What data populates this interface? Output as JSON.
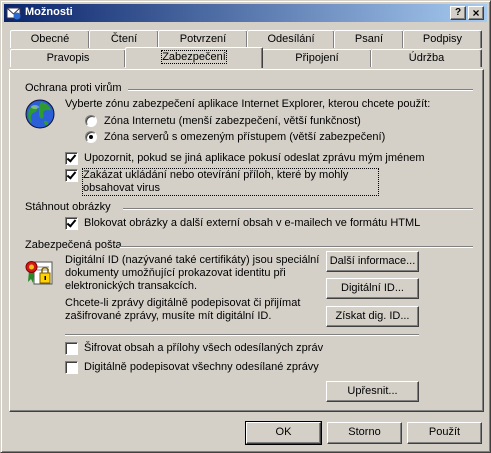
{
  "window": {
    "title": "Možnosti",
    "help_label": "?",
    "close_label": "×"
  },
  "tabs_back": [
    {
      "label": "Obecné"
    },
    {
      "label": "Čtení"
    },
    {
      "label": "Potvrzení"
    },
    {
      "label": "Odesílání"
    },
    {
      "label": "Psaní"
    },
    {
      "label": "Podpisy"
    }
  ],
  "tabs_front": [
    {
      "label": "Pravopis"
    },
    {
      "label": "Zabezpečení",
      "active": true
    },
    {
      "label": "Připojení"
    },
    {
      "label": "Údržba"
    }
  ],
  "virus": {
    "heading": "Ochrana proti virům",
    "zone_prompt": "Vyberte zónu zabezpečení aplikace Internet Explorer, kterou chcete použít:",
    "zone_internet": "Zóna Internetu (menší zabezpečení, větší funkčnost)",
    "zone_internet_selected": false,
    "zone_restricted": "Zóna serverů s omezeným přístupem (větší zabezpečení)",
    "zone_restricted_selected": true,
    "warn_send": "Upozornit, pokud se jiná aplikace pokusí odeslat zprávu mým jménem",
    "warn_send_checked": true,
    "block_attach": "Zakázat ukládání nebo otevírání příloh, které by mohly obsahovat virus",
    "block_attach_checked": true
  },
  "images": {
    "heading": "Stáhnout obrázky",
    "block_external": "Blokovat obrázky a další externí obsah v e-mailech ve formátu HTML",
    "block_external_checked": true
  },
  "secure_mail": {
    "heading": "Zabezpečená pošta",
    "desc_id": "Digitální ID (nazývané také certifikáty) jsou speciální dokumenty umožňující prokazovat identitu při elektronických transakcích.",
    "desc_sign": "Chcete-li zprávy digitálně podepisovat či přijímat zašifrované zprávy, musíte mít digitální ID.",
    "more_info_button": "Další informace...",
    "digital_ids_button": "Digitální ID...",
    "get_id_button": "Získat dig. ID...",
    "encrypt_label": "Šifrovat obsah a přílohy všech odesílaných zpráv",
    "encrypt_checked": false,
    "sign_label": "Digitálně podepisovat všechny odesílané zprávy",
    "sign_checked": false,
    "advanced_button": "Upřesnit..."
  },
  "footer": {
    "ok": "OK",
    "cancel": "Storno",
    "apply": "Použít"
  },
  "icons": {
    "app": "outlook-express-icon",
    "globe": "globe-icon",
    "certificate": "certificate-icon"
  }
}
